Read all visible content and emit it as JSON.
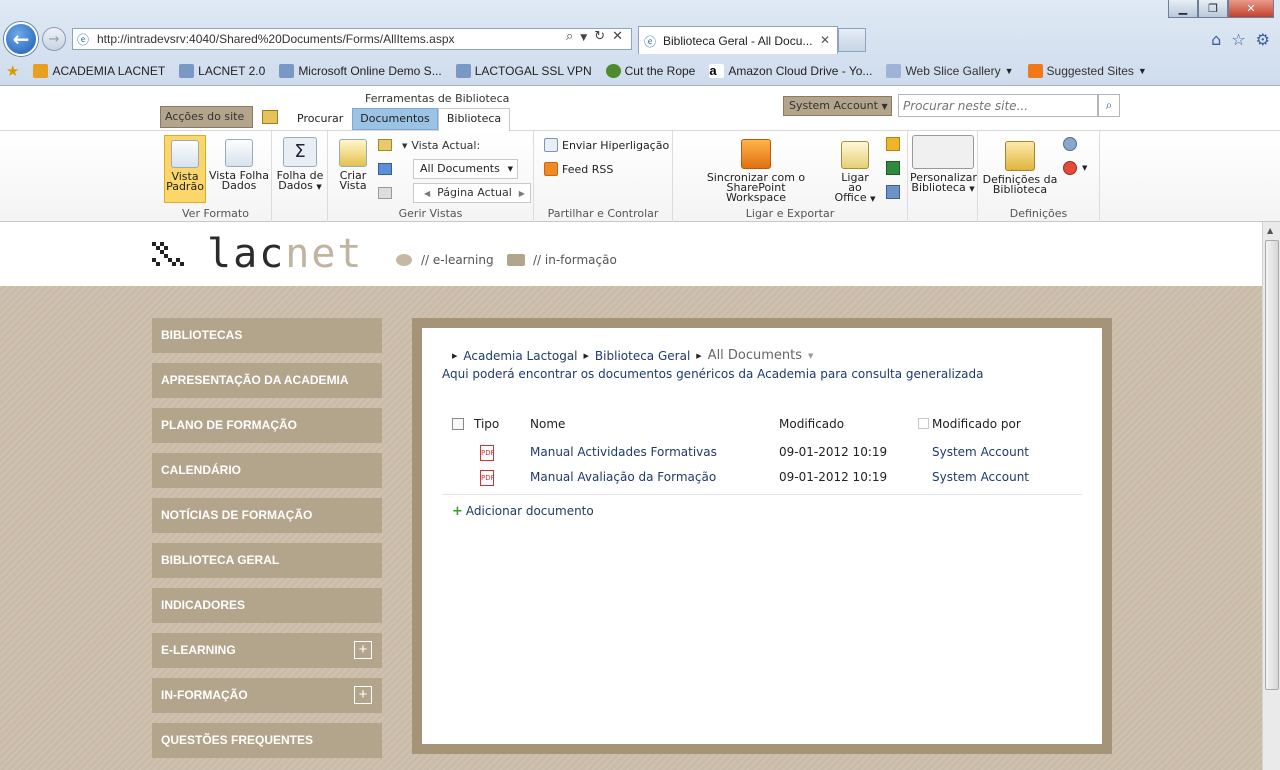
{
  "browser": {
    "address": "http://intradevsrv:4040/Shared%20Documents/Forms/AllItems.aspx",
    "tab_title": "Biblioteca Geral - All Docu...",
    "favorites": [
      "ACADEMIA LACNET",
      "LACNET 2.0",
      "Microsoft Online Demo S...",
      "LACTOGAL SSL VPN",
      "Cut the Rope",
      "Amazon Cloud Drive - Yo...",
      "Web Slice Gallery",
      "Suggested Sites"
    ]
  },
  "ribbon_top": {
    "site_actions": "Acções do site",
    "browse": "Procurar",
    "tools_title": "Ferramentas de Biblioteca",
    "tab_documents": "Documentos",
    "tab_library": "Biblioteca",
    "account": "System Account",
    "search_placeholder": "Procurar neste site..."
  },
  "ribbon": {
    "view_standard": [
      "Vista",
      "Padrão"
    ],
    "view_datasheet": [
      "Vista Folha",
      "Dados"
    ],
    "datasheet": [
      "Folha de",
      "Dados"
    ],
    "create_view": [
      "Criar",
      "Vista"
    ],
    "current_view_label": "Vista Actual:",
    "current_view_value": "All Documents",
    "current_page": "Página Actual",
    "email_link": "Enviar Hiperligação",
    "rss": "Feed RSS",
    "sync": [
      "Sincronizar com o SharePoint",
      "Workspace"
    ],
    "connect_office": [
      "Ligar ao",
      "Office"
    ],
    "customize": [
      "Personalizar",
      "Biblioteca"
    ],
    "settings": [
      "Definições da",
      "Biblioteca"
    ],
    "groups": [
      "Ver Formato",
      "Gerir Vistas",
      "Partilhar e Controlar",
      "Ligar e Exportar",
      "Definições"
    ]
  },
  "site": {
    "logo_dark": "lac",
    "logo_light": "net",
    "link1": "// e-learning",
    "link2": "// in-formação"
  },
  "nav": [
    "BIBLIOTECAS",
    "APRESENTAÇÃO DA ACADEMIA",
    "PLANO DE FORMAÇÃO",
    "CALENDÁRIO",
    "NOTÍCIAS DE FORMAÇÃO",
    "BIBLIOTECA GERAL",
    "INDICADORES",
    "E-LEARNING",
    "IN-FORMAÇÃO",
    "QUESTÕES FREQUENTES"
  ],
  "breadcrumb": [
    "Academia Lactogal",
    "Biblioteca Geral",
    "All Documents"
  ],
  "description": "Aqui poderá encontrar os documentos genéricos da Academia para consulta generalizada",
  "table": {
    "headers": [
      "Tipo",
      "Nome",
      "Modificado",
      "Modificado por"
    ],
    "rows": [
      {
        "name": "Manual Actividades Formativas",
        "modified": "09-01-2012 10:19",
        "by": "System Account"
      },
      {
        "name": "Manual Avaliação da Formação",
        "modified": "09-01-2012 10:19",
        "by": "System Account"
      }
    ]
  },
  "add_document": "Adicionar documento"
}
